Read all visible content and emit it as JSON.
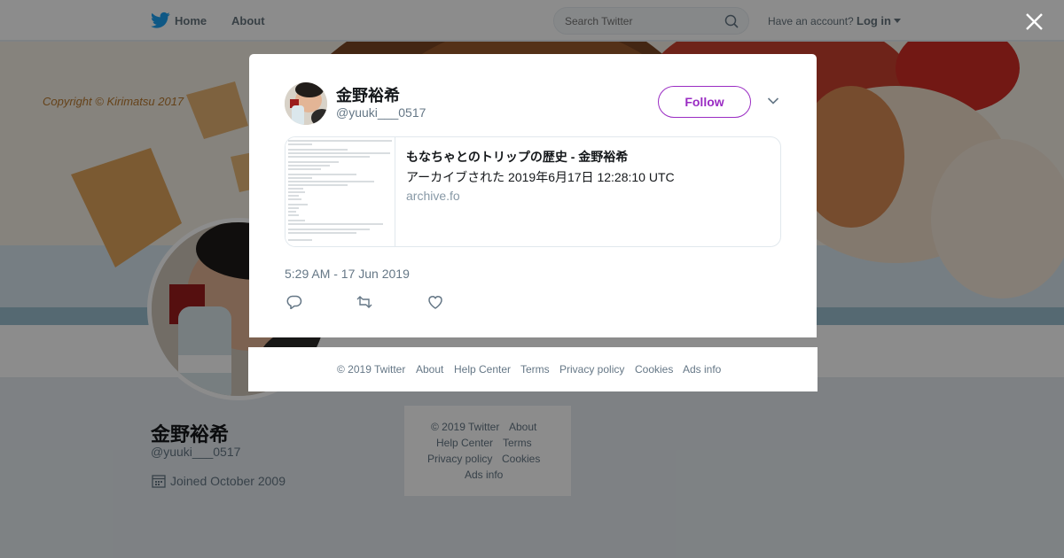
{
  "nav": {
    "home_label": "Home",
    "about_label": "About",
    "search_placeholder": "Search Twitter",
    "account_prompt": "Have an account?",
    "login_label": "Log in",
    "brand_color": "#1da1f2"
  },
  "banner": {
    "copyright_text": "Copyright © Kirimatsu 2017"
  },
  "profile": {
    "name": "金野裕希",
    "handle": "@yuuki___0517",
    "joined": "Joined October 2009"
  },
  "side_footer": {
    "copyright": "© 2019 Twitter",
    "about": "About",
    "help": "Help Center",
    "terms": "Terms",
    "privacy": "Privacy policy",
    "cookies": "Cookies",
    "ads": "Ads info"
  },
  "tweet": {
    "author_name": "金野裕希",
    "author_handle": "@yuuki___0517",
    "follow_label": "Follow",
    "accent_color": "#9a2cc3",
    "card": {
      "title": "もなちゃとのトリップの歴史 - 金野裕希",
      "description": "アーカイブされた 2019年6月17日 12:28:10 UTC",
      "domain": "archive.fo"
    },
    "timestamp": "5:29 AM - 17 Jun 2019",
    "actions": [
      "reply-icon",
      "retweet-icon",
      "like-icon"
    ]
  },
  "modal_footer": {
    "copyright": "© 2019 Twitter",
    "about": "About",
    "help": "Help Center",
    "terms": "Terms",
    "privacy": "Privacy policy",
    "cookies": "Cookies",
    "ads": "Ads info"
  }
}
